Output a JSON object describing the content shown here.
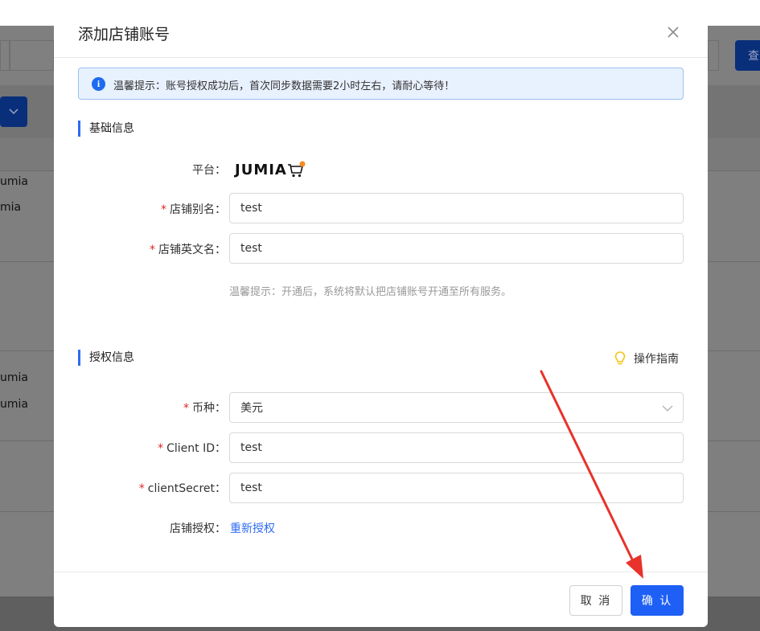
{
  "background": {
    "rows_text": [
      "umia",
      "mia",
      "umia",
      "umia"
    ],
    "query_button_label": "查"
  },
  "modal": {
    "title": "添加店铺账号",
    "alert_text": "温馨提示：账号授权成功后，首次同步数据需要2小时左右，请耐心等待！",
    "basic_section": {
      "title": "基础信息",
      "platform_label": "平台：",
      "platform_logo_text": "JUMIA",
      "alias_label": "店铺别名：",
      "alias_value": "test",
      "english_name_label": "店铺英文名：",
      "english_name_value": "test",
      "hint": "温馨提示：开通后，系统将默认把店铺账号开通至所有服务。"
    },
    "auth_section": {
      "title": "授权信息",
      "guide_label": "操作指南",
      "currency_label": "币种：",
      "currency_value": "美元",
      "client_id_label": "Client ID：",
      "client_id_value": "test",
      "client_secret_label": "clientSecret：",
      "client_secret_value": "test",
      "store_auth_label": "店铺授权：",
      "reauth_link": "重新授权"
    },
    "footer": {
      "cancel_label": "取 消",
      "confirm_label": "确 认"
    }
  },
  "colors": {
    "primary": "#1e5ff5",
    "required": "#e02424",
    "arrow": "#e8322b",
    "overlay": "#7f7f7f"
  }
}
